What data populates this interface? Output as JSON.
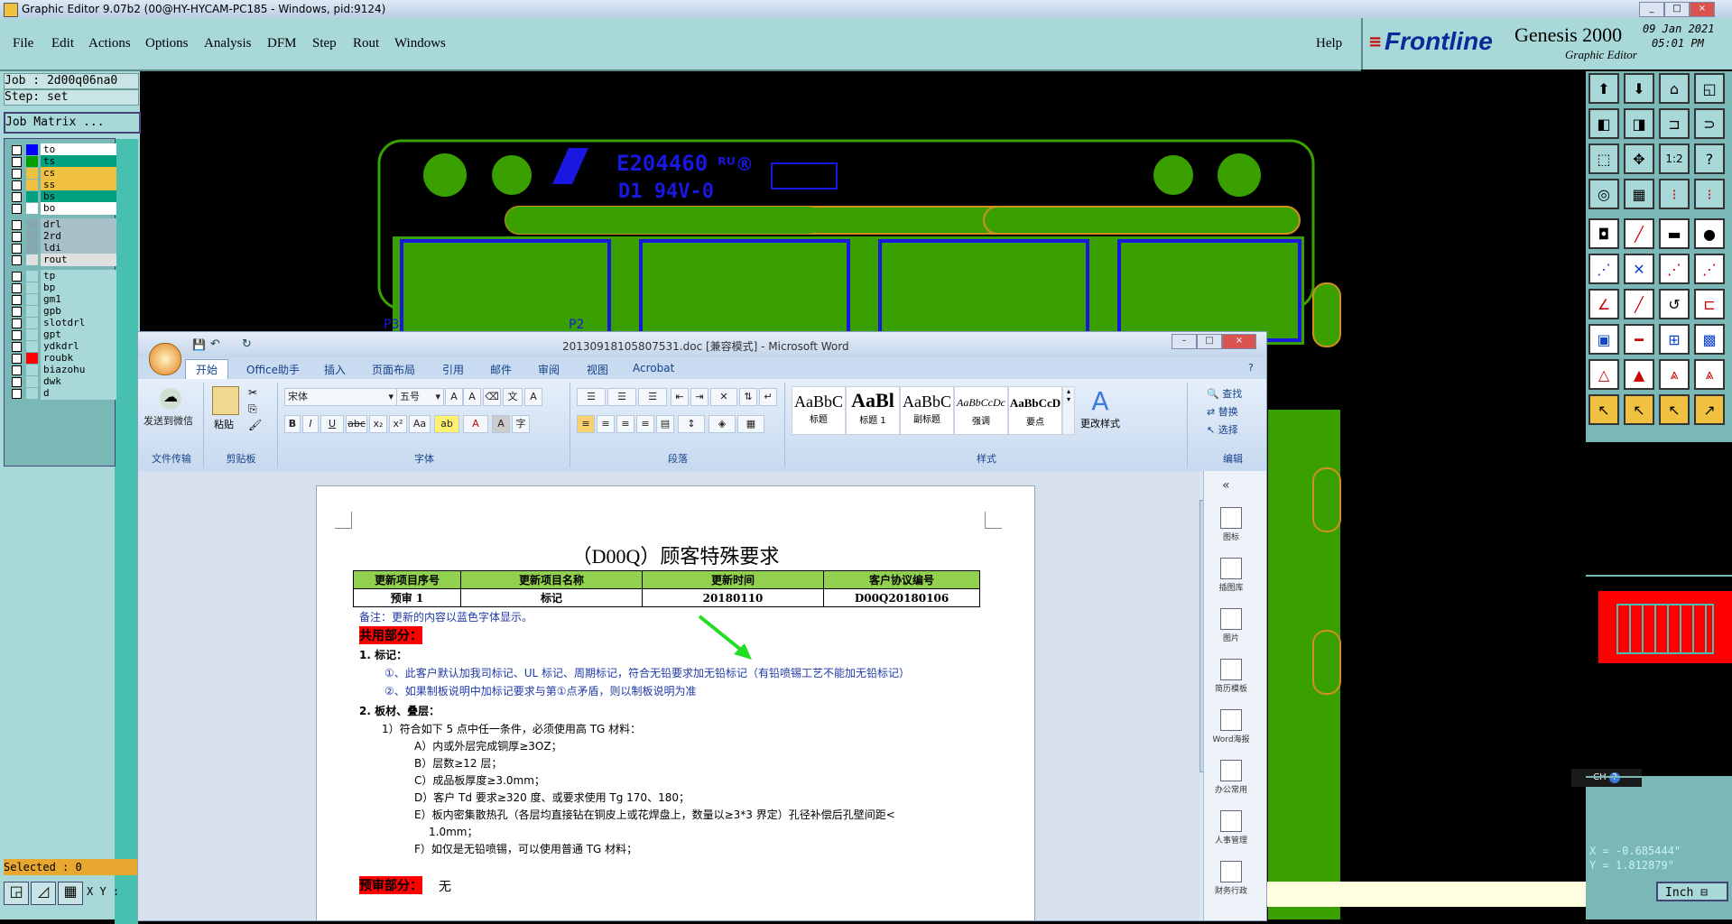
{
  "genesis": {
    "title": "Graphic Editor 9.07b2 (00@HY-HYCAM-PC185 - Windows, pid:9124)",
    "menu": [
      "File",
      "Edit",
      "Actions",
      "Options",
      "Analysis",
      "DFM",
      "Step",
      "Rout",
      "Windows"
    ],
    "help": "Help",
    "brand": {
      "logo": "Frontline",
      "product": "Genesis 2000",
      "subtitle": "Graphic Editor",
      "date": "09 Jan 2021",
      "time": "05:01 PM"
    },
    "job": "Job : 2d00q06na0",
    "step": "Step: set",
    "job_matrix": "Job Matrix ...",
    "layers": [
      {
        "name": "to",
        "swatch": "#0000ff",
        "bg": "#ffffff"
      },
      {
        "name": "ts",
        "swatch": "#00a000",
        "bg": "#00a080"
      },
      {
        "name": "cs",
        "swatch": "#f0c040",
        "bg": "#f0c040"
      },
      {
        "name": "ss",
        "swatch": "#f0c040",
        "bg": "#f0c040"
      },
      {
        "name": "bs",
        "swatch": "#00a080",
        "bg": "#00a080"
      },
      {
        "name": "bo",
        "swatch": "#ffffff",
        "bg": "#ffffff"
      },
      {
        "name": "drl",
        "swatch": "#88a8b0",
        "bg": "#a8c0c8"
      },
      {
        "name": "2rd",
        "swatch": "#88a8b0",
        "bg": "#a8c0c8"
      },
      {
        "name": "ldi",
        "swatch": "#88a8b0",
        "bg": "#a8c0c8"
      },
      {
        "name": "rout",
        "swatch": "#e0e0e0",
        "bg": "#e0e0e0"
      },
      {
        "name": "tp",
        "swatch": "#a8d8d8",
        "bg": "#a8d8d8"
      },
      {
        "name": "bp",
        "swatch": "#a8d8d8",
        "bg": "#a8d8d8"
      },
      {
        "name": "gm1",
        "swatch": "#a8d8d8",
        "bg": "#a8d8d8"
      },
      {
        "name": "gpb",
        "swatch": "#a8d8d8",
        "bg": "#a8d8d8"
      },
      {
        "name": "slotdrl",
        "swatch": "#a8d8d8",
        "bg": "#a8d8d8"
      },
      {
        "name": "gpt",
        "swatch": "#a8d8d8",
        "bg": "#a8d8d8"
      },
      {
        "name": "ydkdrl",
        "swatch": "#a8d8d8",
        "bg": "#a8d8d8"
      },
      {
        "name": "roubk",
        "swatch": "#ff0000",
        "bg": "#a8d8d8"
      },
      {
        "name": "biazohu",
        "swatch": "#a8d8d8",
        "bg": "#a8d8d8"
      },
      {
        "name": "dwk",
        "swatch": "#a8d8d8",
        "bg": "#a8d8d8"
      },
      {
        "name": "d",
        "swatch": "#a8d8d8",
        "bg": "#a8d8d8"
      }
    ],
    "selected": "Selected : 0",
    "xy_label": "X Y :",
    "coord_x": "X = -0.685444\"",
    "coord_y": "Y = 1.812879\"",
    "units": "Inch",
    "pcb_text1": "E204460",
    "pcb_text2": "D1  94V-0",
    "p_labels": [
      "P3",
      "P2"
    ]
  },
  "word": {
    "title": "20130918105807531.doc [兼容模式] - Microsoft Word",
    "tabs": [
      "开始",
      "Office助手",
      "插入",
      "页面布局",
      "引用",
      "邮件",
      "审阅",
      "视图",
      "Acrobat"
    ],
    "groups": [
      "文件传输",
      "剪贴板",
      "字体",
      "段落",
      "样式",
      "编辑"
    ],
    "send_wechat": "发送到微信",
    "paste": "粘贴",
    "font_name": "宋体",
    "font_size": "五号",
    "styles": [
      {
        "preview": "AaBbC",
        "label": "标题"
      },
      {
        "preview": "AaBl",
        "label": "标题 1"
      },
      {
        "preview": "AaBbC",
        "label": "副标题"
      },
      {
        "preview": "AaBbCcDc",
        "label": "强调"
      },
      {
        "preview": "AaBbCcD",
        "label": "要点"
      }
    ],
    "change_styles": "更改样式",
    "edit": [
      "查找",
      "替换",
      "选择"
    ],
    "side_items": [
      "图标",
      "插图库",
      "图片",
      "简历模板",
      "Word海报",
      "办公常用",
      "人事管理",
      "财务行政"
    ],
    "ime": "CH",
    "doc": {
      "title": "（D00Q）顾客特殊要求",
      "headers": [
        "更新项目序号",
        "更新项目名称",
        "更新时间",
        "客户协议编号"
      ],
      "row": [
        "预审 1",
        "标记",
        "20180110",
        "D00Q20180106"
      ],
      "note": "备注：更新的内容以蓝色字体显示。",
      "common": "共用部分：",
      "s1_title": "1.   标记：",
      "s1_a": "①、此客户默认加我司标记、UL 标记、周期标记，符合无铅要求加无铅标记（有铅喷锡工艺不能加无铅标记）",
      "s1_b": "②、如果制板说明中加标记要求与第①点矛盾，则以制板说明为准",
      "s2_title": "2.   板材、叠层：",
      "s2_1": "1）符合如下 5 点中任一条件，必须使用高 TG 材料：",
      "s2_a": "A）内或外层完成铜厚≥3OZ；",
      "s2_b": "B）层数≥12 层；",
      "s2_c": "C）成品板厚度≥3.0mm；",
      "s2_d": "D）客户 Td 要求≥320 度、或要求使用 Tg 170、180；",
      "s2_e": "E）板内密集散热孔（各层均直接钻在铜皮上或花焊盘上，数量以≥3*3 界定）孔径补偿后孔壁间距<",
      "s2_e2": "1.0mm；",
      "s2_f": "F）如仅是无铅喷锡，可以使用普通 TG 材料；",
      "prereview": "预审部分：",
      "none": "无"
    }
  }
}
